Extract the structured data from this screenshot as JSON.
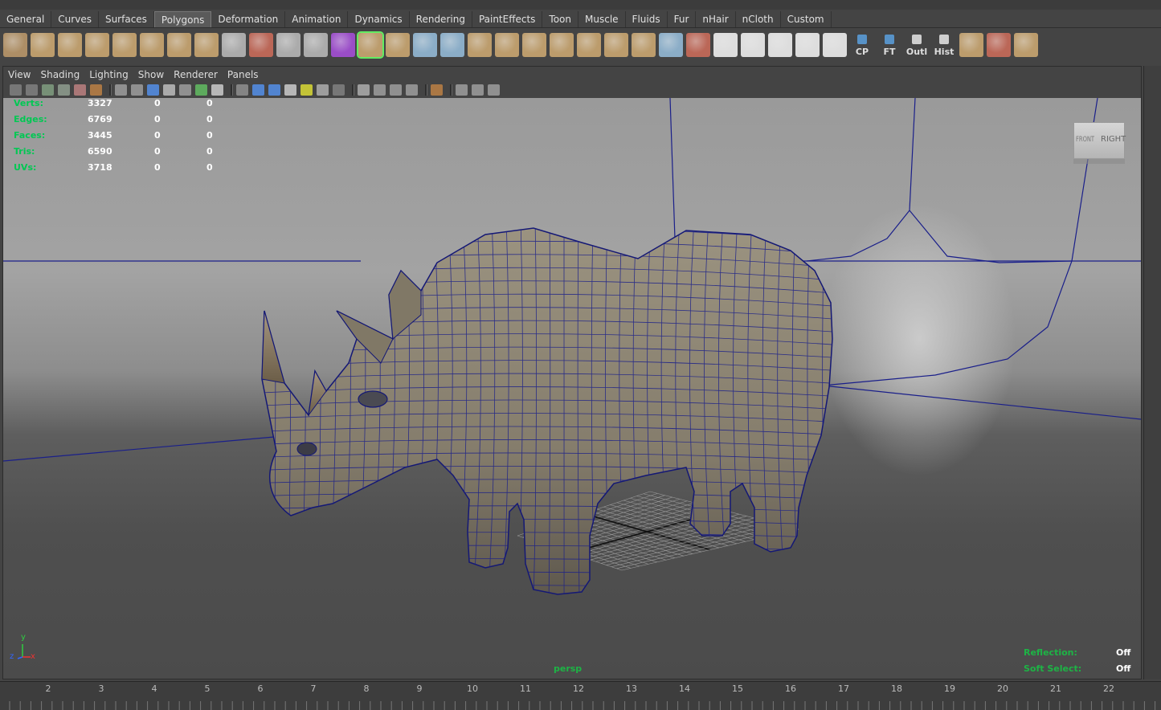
{
  "shelf": {
    "tabs": [
      "General",
      "Curves",
      "Surfaces",
      "Polygons",
      "Deformation",
      "Animation",
      "Dynamics",
      "Rendering",
      "PaintEffects",
      "Toon",
      "Muscle",
      "Fluids",
      "Fur",
      "nHair",
      "nCloth",
      "Custom"
    ],
    "active_tab": "Polygons",
    "icons": [
      {
        "name": "poly-sphere-icon",
        "color": "#b9976a"
      },
      {
        "name": "poly-cube-icon",
        "color": "#c9a671"
      },
      {
        "name": "poly-cylinder-icon",
        "color": "#c9a671"
      },
      {
        "name": "poly-cone-icon",
        "color": "#c9a671"
      },
      {
        "name": "poly-plane-icon",
        "color": "#c9a671"
      },
      {
        "name": "poly-torus-icon",
        "color": "#c9a671"
      },
      {
        "name": "poly-prism-icon",
        "color": "#c9a671"
      },
      {
        "name": "poly-pipe-icon",
        "color": "#c9a671"
      },
      {
        "name": "poly-soccerball-icon",
        "color": "#b7b7b7"
      },
      {
        "name": "reduce-icon",
        "color": "#c86b5a"
      },
      {
        "name": "combine-icon",
        "color": "#b7b7b7"
      },
      {
        "name": "separate-icon",
        "color": "#b7b7b7"
      },
      {
        "name": "smooth-icon",
        "color": "#a44fd6"
      },
      {
        "name": "extrude-icon",
        "color": "#c9a671"
      },
      {
        "name": "bridge-icon",
        "color": "#c9a671"
      },
      {
        "name": "append-icon",
        "color": "#93b9d6"
      },
      {
        "name": "split-icon",
        "color": "#93b9d6"
      },
      {
        "name": "insert-loop-icon",
        "color": "#c9a671"
      },
      {
        "name": "offset-loop-icon",
        "color": "#c9a671"
      },
      {
        "name": "add-division-icon",
        "color": "#c9a671"
      },
      {
        "name": "bevel-icon",
        "color": "#c9a671"
      },
      {
        "name": "merge-icon",
        "color": "#c9a671"
      },
      {
        "name": "collapse-icon",
        "color": "#c9a671"
      },
      {
        "name": "wedge-icon",
        "color": "#c9a671"
      },
      {
        "name": "cut-faces-icon",
        "color": "#93b9d6"
      },
      {
        "name": "sculpt-icon",
        "color": "#c86b5a"
      },
      {
        "name": "planar-map-icon",
        "color": "#eeeeee"
      },
      {
        "name": "cylindrical-map-icon",
        "color": "#eeeeee"
      },
      {
        "name": "spherical-map-icon",
        "color": "#eeeeee"
      },
      {
        "name": "auto-map-icon",
        "color": "#eeeeee"
      },
      {
        "name": "uv-editor-icon",
        "color": "#eeeeee"
      }
    ],
    "labeled_icons": [
      {
        "name": "cp-button",
        "label": "CP",
        "color": "#5a9bd6"
      },
      {
        "name": "ft-button",
        "label": "FT",
        "color": "#5a9bd6"
      },
      {
        "name": "outliner-button",
        "label": "Outl",
        "color": "#dddddd"
      },
      {
        "name": "history-button",
        "label": "Hist",
        "color": "#dddddd"
      }
    ],
    "tail_icons": [
      {
        "name": "transfer-icon",
        "color": "#c9a671"
      },
      {
        "name": "select-faces-icon",
        "color": "#c86b5a"
      },
      {
        "name": "measure-icon",
        "color": "#c9a671"
      }
    ]
  },
  "panel": {
    "menu": [
      "View",
      "Shading",
      "Lighting",
      "Show",
      "Renderer",
      "Panels"
    ],
    "camera_name": "persp",
    "view_cube": {
      "front": "FRONT",
      "right": "RIGHT"
    }
  },
  "poly_count": {
    "rows": [
      {
        "label": "Verts:",
        "values": [
          "3327",
          "0",
          "0"
        ]
      },
      {
        "label": "Edges:",
        "values": [
          "6769",
          "0",
          "0"
        ]
      },
      {
        "label": "Faces:",
        "values": [
          "3445",
          "0",
          "0"
        ]
      },
      {
        "label": "Tris:",
        "values": [
          "6590",
          "0",
          "0"
        ]
      },
      {
        "label": "UVs:",
        "values": [
          "3718",
          "0",
          "0"
        ]
      }
    ]
  },
  "status_hud": {
    "reflection_label": "Reflection:",
    "reflection_value": "Off",
    "soft_select_label": "Soft Select:",
    "soft_select_value": "Off"
  },
  "axis": {
    "y": "y",
    "z": "z",
    "x": "x"
  },
  "timeline": {
    "ticks": [
      "2",
      "3",
      "4",
      "5",
      "6",
      "7",
      "8",
      "9",
      "10",
      "11",
      "12",
      "13",
      "14",
      "15",
      "16",
      "17",
      "18",
      "19",
      "20",
      "21",
      "22"
    ]
  },
  "colors": {
    "wire": "#1a1f8a",
    "hud_green": "#1db445"
  }
}
